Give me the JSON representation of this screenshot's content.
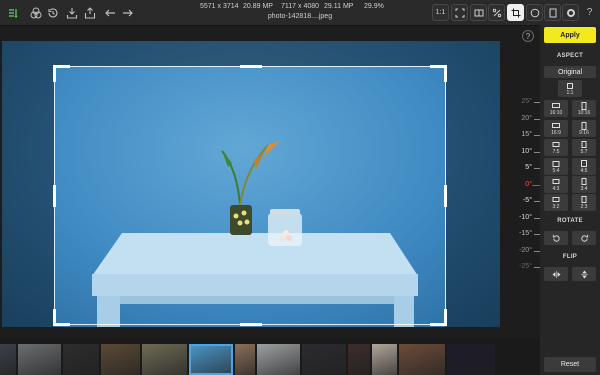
{
  "toolbar": {
    "left_icons": [
      "crop-mode-icon",
      "filters-icon",
      "history-icon",
      "import-icon",
      "export-icon",
      "undo-icon",
      "redo-icon"
    ],
    "image_size": "5571 x 3714",
    "image_mp": "20.89 MP",
    "output_size": "7117 x 4080",
    "output_mp": "29.11 MP",
    "zoom": "29.9%",
    "filename": "photo-142818....jpeg",
    "zoom_label": "1:1"
  },
  "side": {
    "help": "?",
    "apply_label": "Apply",
    "aspect_title": "ASPECT",
    "original_label": "Original",
    "ratios": [
      "1:1",
      "16:10",
      "10:16",
      "16:9",
      "9:16",
      "7:5",
      "5:7",
      "5:4",
      "4:5",
      "4:3",
      "3:4",
      "3:2",
      "2:3"
    ],
    "rotate_title": "ROTATE",
    "flip_title": "FLIP",
    "reset_label": "Reset"
  },
  "ruler": {
    "ticks": [
      "25°",
      "20°",
      "15°",
      "10°",
      "5°",
      "0°",
      "-5°",
      "-10°",
      "-15°",
      "-20°",
      "-25°"
    ],
    "current_angle": 0
  },
  "colors": {
    "accent_yellow": "#f4e91d",
    "zero_marker": "#e53935",
    "selected_thumb": "#4fa3e0"
  },
  "filmstrip": {
    "selected_index": 5,
    "thumbnails": [
      "#3c4148",
      "#6b6e70",
      "#2d2d2d",
      "#5b4a36",
      "#6e6a55",
      "#4b98cc",
      "#8a6f5a",
      "#9da0a2",
      "#2c2b2f",
      "#3c2d2b",
      "#b1a69a",
      "#6c4c3b",
      "#1d1c2c"
    ]
  }
}
